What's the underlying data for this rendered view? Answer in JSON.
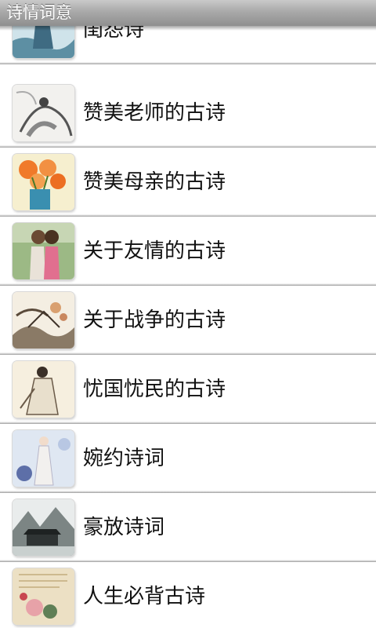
{
  "app": {
    "title": "诗情词意"
  },
  "list": {
    "items": [
      {
        "label": "闺怨诗",
        "thumbnail": "lady-portrait-image"
      },
      {
        "label": "赞美老师的古诗",
        "thumbnail": "ink-scholar-image"
      },
      {
        "label": "赞美母亲的古诗",
        "thumbnail": "carnation-vase-image"
      },
      {
        "label": "关于友情的古诗",
        "thumbnail": "two-friends-image"
      },
      {
        "label": "关于战争的古诗",
        "thumbnail": "ink-landscape-image"
      },
      {
        "label": "忧国忧民的古诗",
        "thumbnail": "poet-figure-image"
      },
      {
        "label": "婉约诗词",
        "thumbnail": "lady-blossom-image"
      },
      {
        "label": "豪放诗词",
        "thumbnail": "mountain-pavilion-image"
      },
      {
        "label": "人生必背古诗",
        "thumbnail": "lotus-parchment-image"
      }
    ]
  }
}
